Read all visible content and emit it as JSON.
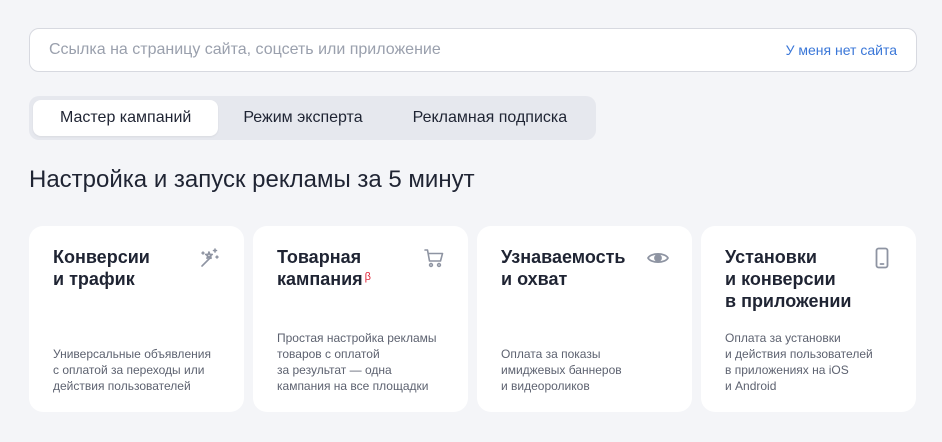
{
  "search": {
    "placeholder": "Ссылка на страницу сайта, соцсеть или приложение",
    "value": "",
    "no_site_link": "У меня нет сайта"
  },
  "tabs": [
    {
      "label": "Мастер кампаний",
      "active": true
    },
    {
      "label": "Режим эксперта",
      "active": false
    },
    {
      "label": "Рекламная подписка",
      "active": false
    }
  ],
  "headline": "Настройка и запуск рекламы за 5 минут",
  "cards": [
    {
      "title": "Конверсии\nи трафик",
      "badge": "",
      "description": "Универсальные объявления\nс оплатой за переходы или\nдействия пользователей",
      "icon": "magic-wand-icon"
    },
    {
      "title": "Товарная\nкампания",
      "badge": "β",
      "description": "Простая настройка рекламы\nтоваров с оплатой\nза результат — одна\nкампания на все площадки",
      "icon": "cart-icon"
    },
    {
      "title": "Узнаваемость\nи охват",
      "badge": "",
      "description": "Оплата за показы\nимиджевых баннеров\nи видеороликов",
      "icon": "eye-icon"
    },
    {
      "title": "Установки\nи конверсии\nв приложении",
      "badge": "",
      "description": "Оплата за установки\nи действия пользователей\nв приложениях на iOS\nи Android",
      "icon": "phone-icon"
    }
  ],
  "colors": {
    "background": "#f4f5f8",
    "link": "#3a77d8",
    "beta": "#e0263a",
    "icon": "#8e94a2"
  }
}
